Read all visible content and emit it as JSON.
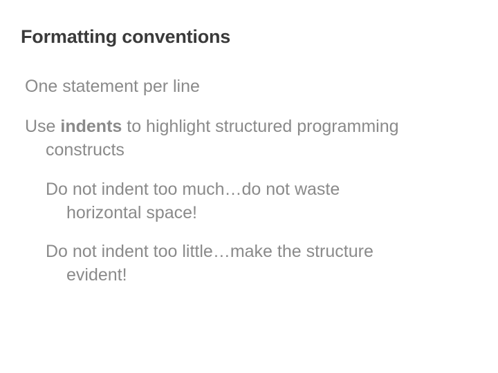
{
  "title": "Formatting conventions",
  "bullets": {
    "b1": "One statement per line",
    "b2_pre": "Use ",
    "b2_bold": "indents",
    "b2_post": " to highlight structured programming",
    "b2_cont": "constructs",
    "b3_line1": "Do not indent too much…do not waste",
    "b3_cont": "horizontal space!",
    "b4_line1": "Do not indent too little…make the structure",
    "b4_cont": "evident!"
  }
}
